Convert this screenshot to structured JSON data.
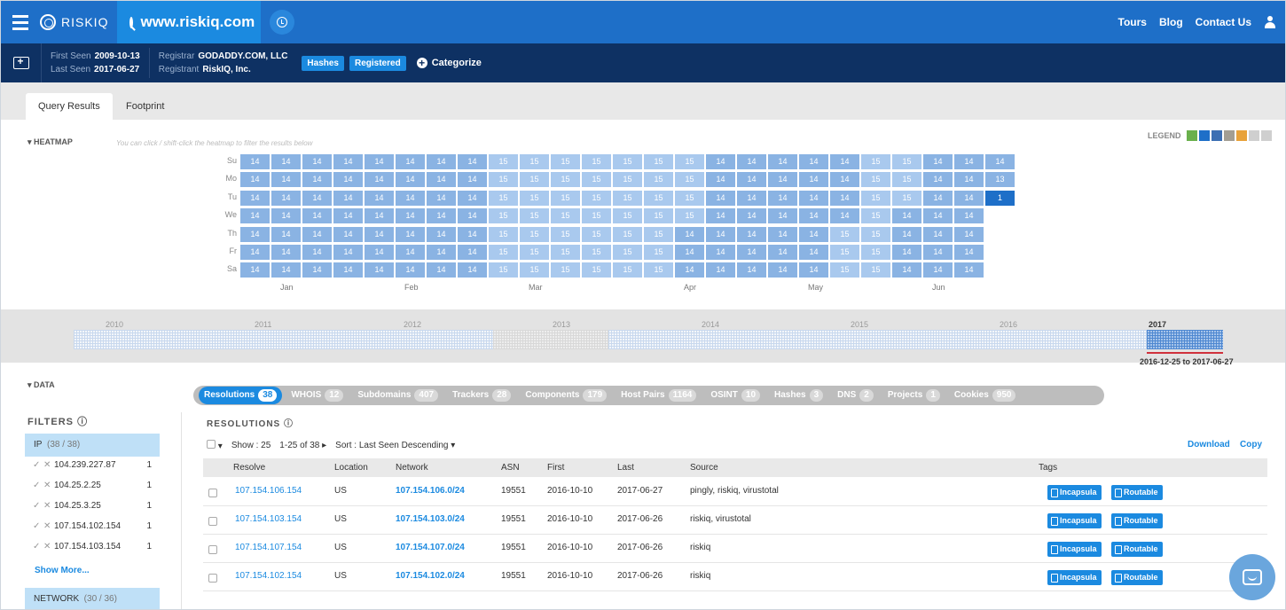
{
  "topbar": {
    "logo": "RISKIQ",
    "search_value": "www.riskiq.com",
    "links": [
      "Tours",
      "Blog",
      "Contact Us"
    ]
  },
  "info": {
    "first_seen_label": "First Seen",
    "first_seen": "2009-10-13",
    "last_seen_label": "Last Seen",
    "last_seen": "2017-06-27",
    "registrar_label": "Registrar",
    "registrar": "GODADDY.COM, LLC",
    "registrant_label": "Registrant",
    "registrant": "RiskIQ, Inc.",
    "tags": [
      "Hashes",
      "Registered"
    ],
    "categorize": "Categorize"
  },
  "tabs": [
    "Query Results",
    "Footprint"
  ],
  "heatmap": {
    "label": "▾ HEATMAP",
    "hint": "You can click / shift-click the heatmap to filter the results below",
    "legend": "LEGEND",
    "legend_colors": [
      "#6ab04c",
      "#1e6fc8",
      "#3c6fb3",
      "#a39e93",
      "#e8a23a",
      "#cfcfcf",
      "#cfcfcf"
    ],
    "days": [
      "Su",
      "Mo",
      "Tu",
      "We",
      "Th",
      "Fr",
      "Sa"
    ],
    "months": [
      {
        "label": "Jan",
        "week": 1
      },
      {
        "label": "Feb",
        "week": 5
      },
      {
        "label": "Mar",
        "week": 9
      },
      {
        "label": "Apr",
        "week": 14
      },
      {
        "label": "May",
        "week": 18
      },
      {
        "label": "Jun",
        "week": 22
      }
    ],
    "weeks": [
      [
        "14",
        "14",
        "14",
        "14",
        "14",
        "14",
        "14"
      ],
      [
        "14",
        "14",
        "14",
        "14",
        "14",
        "14",
        "14"
      ],
      [
        "14",
        "14",
        "14",
        "14",
        "14",
        "14",
        "14"
      ],
      [
        "14",
        "14",
        "14",
        "14",
        "14",
        "14",
        "14"
      ],
      [
        "14",
        "14",
        "14",
        "14",
        "14",
        "14",
        "14"
      ],
      [
        "14",
        "14",
        "14",
        "14",
        "14",
        "14",
        "14"
      ],
      [
        "14",
        "14",
        "14",
        "14",
        "14",
        "14",
        "14"
      ],
      [
        "14",
        "14",
        "14",
        "14",
        "14",
        "14",
        "14"
      ],
      [
        "15",
        "15",
        "15",
        "15",
        "15",
        "15",
        "15"
      ],
      [
        "15",
        "15",
        "15",
        "15",
        "15",
        "15",
        "15"
      ],
      [
        "15",
        "15",
        "15",
        "15",
        "15",
        "15",
        "15"
      ],
      [
        "15",
        "15",
        "15",
        "15",
        "15",
        "15",
        "15"
      ],
      [
        "15",
        "15",
        "15",
        "15",
        "15",
        "15",
        "15"
      ],
      [
        "15",
        "15",
        "15",
        "15",
        "15",
        "15",
        "15"
      ],
      [
        "15",
        "15",
        "15",
        "15",
        "14",
        "14",
        "14"
      ],
      [
        "14",
        "14",
        "14",
        "14",
        "14",
        "14",
        "14"
      ],
      [
        "14",
        "14",
        "14",
        "14",
        "14",
        "14",
        "14"
      ],
      [
        "14",
        "14",
        "14",
        "14",
        "14",
        "14",
        "14"
      ],
      [
        "14",
        "14",
        "14",
        "14",
        "14",
        "14",
        "14"
      ],
      [
        "14",
        "14",
        "14",
        "14",
        "15",
        "15",
        "15"
      ],
      [
        "15",
        "15",
        "15",
        "15",
        "15",
        "15",
        "15"
      ],
      [
        "15",
        "15",
        "15",
        "14",
        "14",
        "14",
        "14"
      ],
      [
        "14",
        "14",
        "14",
        "14",
        "14",
        "14",
        "14"
      ],
      [
        "14",
        "14",
        "14",
        "14",
        "14",
        "14",
        "14"
      ],
      [
        "14",
        "13",
        "1",
        "",
        "",
        "",
        ""
      ]
    ]
  },
  "timeline": {
    "years": [
      "2010",
      "2011",
      "2012",
      "2013",
      "2014",
      "2015",
      "2016",
      "2017"
    ],
    "range": "2016-12-25 to 2017-06-27"
  },
  "data_label": "▾ DATA",
  "data_tabs": [
    {
      "label": "Resolutions",
      "count": "38"
    },
    {
      "label": "WHOIS",
      "count": "12"
    },
    {
      "label": "Subdomains",
      "count": "407"
    },
    {
      "label": "Trackers",
      "count": "28"
    },
    {
      "label": "Components",
      "count": "179"
    },
    {
      "label": "Host Pairs",
      "count": "1164"
    },
    {
      "label": "OSINT",
      "count": "10"
    },
    {
      "label": "Hashes",
      "count": "3"
    },
    {
      "label": "DNS",
      "count": "2"
    },
    {
      "label": "Projects",
      "count": "1"
    },
    {
      "label": "Cookies",
      "count": "950"
    }
  ],
  "filters": {
    "title": "FILTERS",
    "ip_label": "IP",
    "ip_count": "(38 / 38)",
    "items": [
      {
        "value": "104.239.227.87",
        "count": "1"
      },
      {
        "value": "104.25.2.25",
        "count": "1"
      },
      {
        "value": "104.25.3.25",
        "count": "1"
      },
      {
        "value": "107.154.102.154",
        "count": "1"
      },
      {
        "value": "107.154.103.154",
        "count": "1"
      }
    ],
    "show_more": "Show More...",
    "network_label": "NETWORK",
    "network_count": "(30 / 36)"
  },
  "resolutions": {
    "title": "RESOLUTIONS",
    "show": "Show : 25",
    "pager": "1-25 of 38",
    "sort": "Sort : Last Seen Descending",
    "download": "Download",
    "copy": "Copy",
    "columns": [
      "Resolve",
      "Location",
      "Network",
      "ASN",
      "First",
      "Last",
      "Source",
      "Tags"
    ],
    "rows": [
      {
        "resolve": "107.154.106.154",
        "location": "US",
        "network": "107.154.106.0/24",
        "asn": "19551",
        "first": "2016-10-10",
        "last": "2017-06-27",
        "source": "pingly, riskiq, virustotal",
        "tags": [
          "Incapsula",
          "Routable"
        ]
      },
      {
        "resolve": "107.154.103.154",
        "location": "US",
        "network": "107.154.103.0/24",
        "asn": "19551",
        "first": "2016-10-10",
        "last": "2017-06-26",
        "source": "riskiq, virustotal",
        "tags": [
          "Incapsula",
          "Routable"
        ]
      },
      {
        "resolve": "107.154.107.154",
        "location": "US",
        "network": "107.154.107.0/24",
        "asn": "19551",
        "first": "2016-10-10",
        "last": "2017-06-26",
        "source": "riskiq",
        "tags": [
          "Incapsula",
          "Routable"
        ]
      },
      {
        "resolve": "107.154.102.154",
        "location": "US",
        "network": "107.154.102.0/24",
        "asn": "19551",
        "first": "2016-10-10",
        "last": "2017-06-26",
        "source": "riskiq",
        "tags": [
          "Incapsula",
          "Routable"
        ]
      }
    ]
  }
}
